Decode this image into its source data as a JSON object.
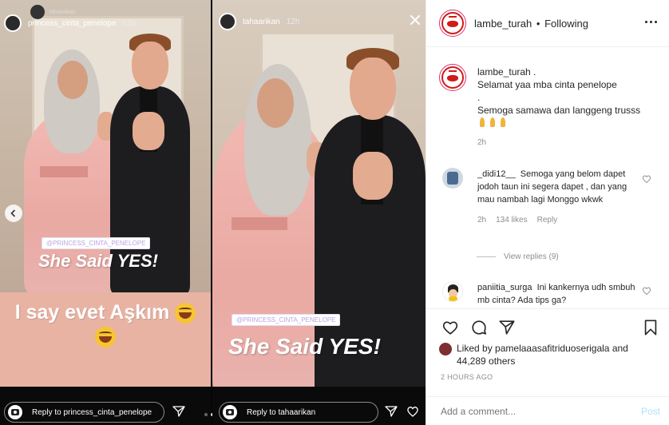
{
  "stories": {
    "left": {
      "user_top": "tahaarikan",
      "user": "princess_cinta_penelope",
      "time": "12h",
      "mention": "@PRINCESS_CINTA_PENELOPE",
      "caption": "She Said YES!",
      "text_line1": "I say evet Aşkım",
      "reply_placeholder": "Reply to princess_cinta_penelope"
    },
    "right": {
      "user": "tahaarikan",
      "time": "12h",
      "mention": "@PRINCESS_CINTA_PENELOPE",
      "caption": "She Said YES!",
      "reply_placeholder": "Reply to tahaarikan"
    }
  },
  "post": {
    "username": "lambe_turah",
    "following": "Following",
    "separator": "•",
    "caption": {
      "username": "lambe_turah .",
      "lines": [
        "Selamat yaa mba cinta penelope",
        ".",
        "Semoga samawa dan langgeng trusss"
      ],
      "time": "2h"
    },
    "comments": [
      {
        "username": "_didi12__",
        "text": "Semoga yang belom dapet jodoh taun ini segera dapet , dan yang mau nambah lagi Monggo wkwk",
        "time": "2h",
        "likes": "134 likes",
        "reply": "Reply",
        "view_replies": "View replies (9)"
      },
      {
        "username": "paniitia_surga",
        "text": "Ini kankernya udh smbuh mb cinta? Ada tips ga?"
      }
    ],
    "likes": {
      "prefix": "Liked by",
      "user": "pamelaaasafitriduoserigala",
      "and": "and",
      "others": "44,289 others"
    },
    "time_ago": "2 HOURS AGO",
    "add_comment_placeholder": "Add a comment...",
    "post_label": "Post"
  },
  "colors": {
    "brand_red": "#d01b1b",
    "post_button": "#b2dffc",
    "muted": "#8e8e8e"
  }
}
